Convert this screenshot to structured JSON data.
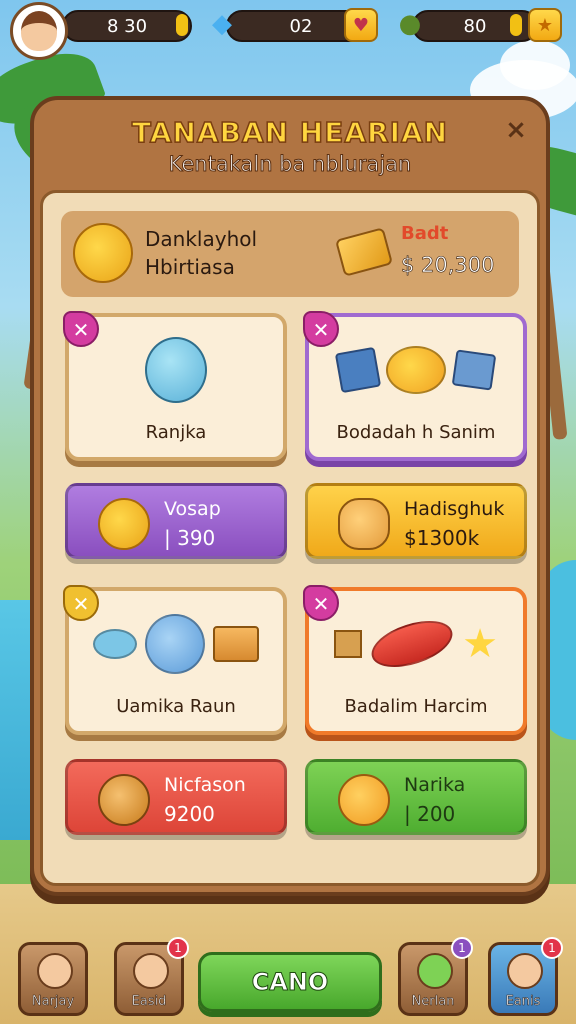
{
  "hud": {
    "coins": "8 30",
    "gems": "02",
    "gem_plus_icon": "heart-icon",
    "energy": "80",
    "energy_plus_icon": "star-icon"
  },
  "panel": {
    "title": "TANABAN HEARIAN",
    "subtitle": "Kentakaln ba nblurajan",
    "close_label": "×"
  },
  "featured": {
    "name_line1": "Danklayhol",
    "name_line2": "Hbirtiasa",
    "tag": "Badt",
    "price": "$ 20,300"
  },
  "items": [
    {
      "label": "Ranjka",
      "badge": "✕",
      "color": "cream"
    },
    {
      "label": "Bodadah h Sanim",
      "badge": "✕",
      "color": "purple"
    },
    {
      "label": "Uamika Raun",
      "badge": "✕",
      "color": "cream"
    },
    {
      "label": "Badalim Harcim",
      "badge": "✕",
      "color": "orange"
    }
  ],
  "offers": [
    {
      "title": "Vosap",
      "price": "| 390",
      "color": "purple"
    },
    {
      "title": "Hadisghuk",
      "price": "$1300k",
      "color": "yellow"
    },
    {
      "title": "Nicfason",
      "price": "9200",
      "color": "red"
    },
    {
      "title": "Narika",
      "price": "| 200",
      "color": "green"
    }
  ],
  "bottom_nav": {
    "items": [
      {
        "label": "Narjay",
        "badge": ""
      },
      {
        "label": "Easid",
        "badge": "1"
      },
      {
        "label": "Nerlan",
        "badge": "1"
      },
      {
        "label": "Eanis",
        "badge": "1"
      }
    ],
    "cta_label": "CANO"
  }
}
